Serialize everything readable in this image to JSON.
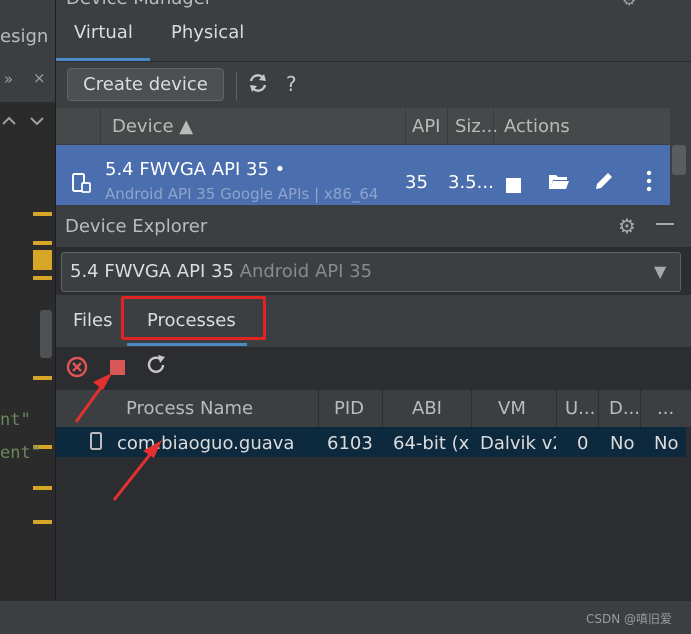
{
  "left_editor": {
    "design_tab": "esign",
    "overflow": "»",
    "close": "×",
    "up": "^",
    "down": "v",
    "code_line1": "nt\"",
    "code_line2": "ent\""
  },
  "device_manager": {
    "title": "Device Manager",
    "tabs": [
      "Virtual",
      "Physical"
    ],
    "selected_tab": "Virtual",
    "create_button": "Create device",
    "refresh_icon": "refresh-icon",
    "help_label": "?",
    "columns": {
      "device": "Device",
      "api": "API",
      "size": "Siz...",
      "actions": "Actions"
    },
    "device": {
      "name": "5.4  FWVGA API 35  •",
      "subtitle": "Android API 35 Google APIs | x86_64",
      "api": "35",
      "size": "3.5..."
    }
  },
  "device_explorer": {
    "title": "Device Explorer",
    "selected_device": "5.4  FWVGA API 35",
    "selected_device_sub": "Android API 35",
    "tabs": [
      "Files",
      "Processes"
    ],
    "selected_tab": "Processes",
    "columns": {
      "process_name": "Process Name",
      "pid": "PID",
      "abi": "ABI",
      "vm": "VM",
      "u": "U...",
      "d": "D...",
      "more": "..."
    },
    "process": {
      "name": "com.biaoguo.guava",
      "pid": "6103",
      "abi": "64-bit (x",
      "vm": "Dalvik v2",
      "u": "0",
      "d": "No",
      "extra": "No"
    }
  },
  "watermark": "CSDN @嗔旧爱",
  "colors": {
    "accent": "#4a88c7",
    "selection": "#4b6eaf",
    "annotation": "#e02424"
  }
}
